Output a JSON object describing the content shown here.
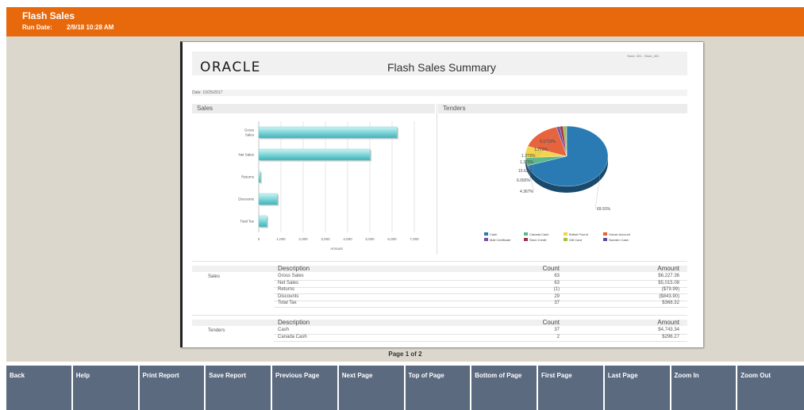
{
  "app": {
    "title": "Flash Sales",
    "run_date_label": "Run Date:",
    "run_date_value": "2/9/18 10:28 AM",
    "accent_color": "#e8690b"
  },
  "report": {
    "logo": "ORACLE",
    "title": "Flash Sales Summary",
    "store": "Store: 401 - Store_401",
    "date": "Date: 10/25/2017",
    "sales_section": "Sales",
    "tenders_section": "Tenders"
  },
  "chart_data": [
    {
      "type": "bar",
      "title": "Sales",
      "orientation": "horizontal",
      "categories": [
        "Gross Sales",
        "Net Sales",
        "Returns",
        "Discounts",
        "Total Tax"
      ],
      "values": [
        6227.36,
        5015.08,
        79.99,
        843.9,
        368.32
      ],
      "xlabel": "Amount",
      "xlim": [
        0,
        7000
      ],
      "xticks": [
        "0",
        "1,000",
        "2,000",
        "3,000",
        "4,000",
        "5,000",
        "6,000",
        "7,000"
      ],
      "grid": true
    },
    {
      "type": "pie",
      "title": "Tenders",
      "slices": [
        {
          "name": "Cash",
          "value": 69.91,
          "label": "69.91%",
          "color": "#2a7ab3"
        },
        {
          "name": "Canada Cash",
          "value": 4.367,
          "label": "4.367%",
          "color": "#5db88a"
        },
        {
          "name": "British Pound",
          "value": 6.092,
          "label": "6.092%",
          "color": "#f3d44b"
        },
        {
          "name": "House Account",
          "value": 15.63,
          "label": "15.63%",
          "color": "#e8623c"
        },
        {
          "name": "Mall Certificate",
          "value": 1.273,
          "label": "1.273%",
          "color": "#7a4fa0"
        },
        {
          "name": "Store Credit",
          "value": 1.273,
          "label": "1.273%",
          "color": "#a0304a"
        },
        {
          "name": "Gift Card",
          "value": 1.273,
          "label": "1.273%",
          "color": "#9bc53d"
        },
        {
          "name": "Sweden Cash",
          "value": 0.1722,
          "label": "0.1722%",
          "color": "#5b4a9a"
        }
      ],
      "legend_placement": "bottom"
    }
  ],
  "sales_table": {
    "section_label": "Sales",
    "headers": {
      "description": "Description",
      "count": "Count",
      "amount": "Amount"
    },
    "rows": [
      {
        "description": "Gross Sales",
        "count": "63",
        "amount": "$6,227.36"
      },
      {
        "description": "Net Sales",
        "count": "63",
        "amount": "$5,015.08"
      },
      {
        "description": "Returns",
        "count": "(1)",
        "amount": "($79.99)"
      },
      {
        "description": "Discounts",
        "count": "29",
        "amount": "($843.90)"
      },
      {
        "description": "Total Tax",
        "count": "37",
        "amount": "$368.32"
      }
    ]
  },
  "tenders_table": {
    "section_label": "Tenders",
    "headers": {
      "description": "Description",
      "count": "Count",
      "amount": "Amount"
    },
    "rows": [
      {
        "description": "Cash",
        "count": "37",
        "amount": "$4,743.34"
      },
      {
        "description": "Canada Cash",
        "count": "2",
        "amount": "$296.27"
      }
    ]
  },
  "pagination": {
    "text": "Page 1 of 2"
  },
  "toolbar": {
    "buttons": [
      "Back",
      "Help",
      "Print Report",
      "Save Report",
      "Previous Page",
      "Next Page",
      "Top of Page",
      "Bottom of Page",
      "First Page",
      "Last Page",
      "Zoom In",
      "Zoom Out"
    ]
  }
}
